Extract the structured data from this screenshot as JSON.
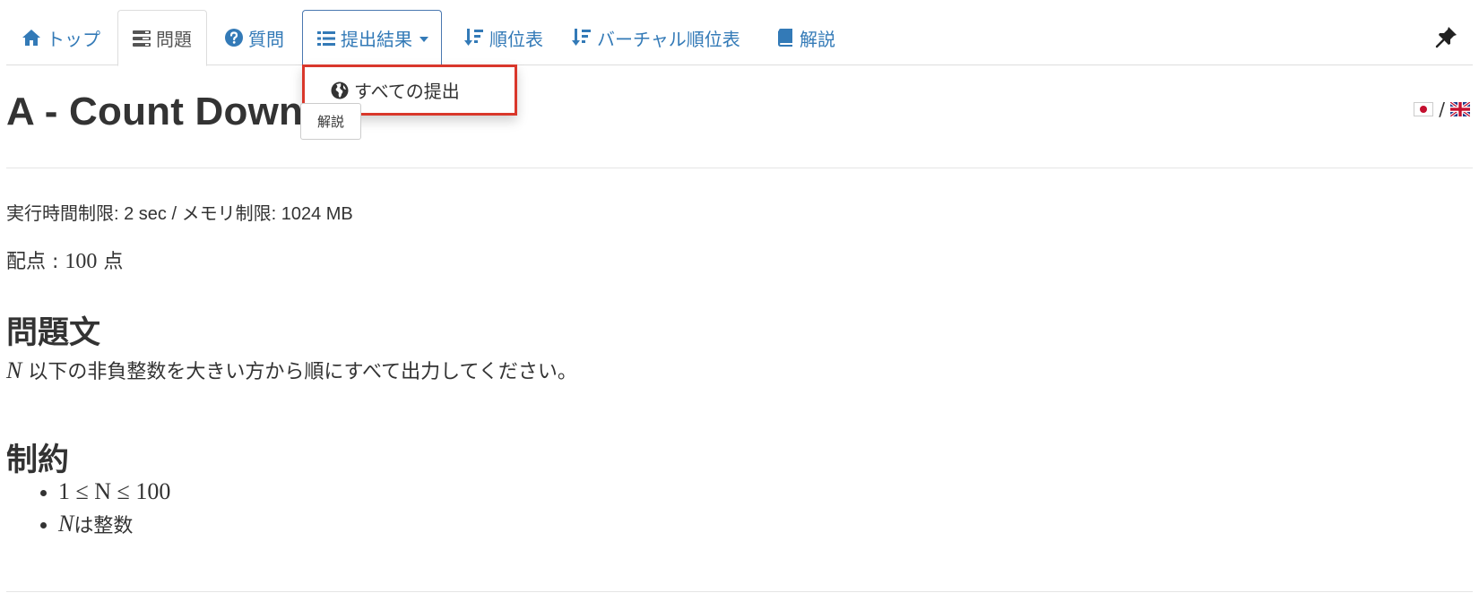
{
  "nav": {
    "tabs": [
      {
        "label": "トップ",
        "icon": "home-icon"
      },
      {
        "label": "問題",
        "icon": "tasks-icon",
        "active": true
      },
      {
        "label": "質問",
        "icon": "question-circle-icon"
      },
      {
        "label": "提出結果",
        "icon": "list-icon",
        "open": true
      },
      {
        "label": "順位表",
        "icon": "sort-amount-icon"
      },
      {
        "label": "バーチャル順位表",
        "icon": "sort-amount-icon"
      },
      {
        "label": "解説",
        "icon": "book-icon"
      }
    ],
    "pin_icon": "pushpin-icon"
  },
  "dropdown": {
    "items": [
      {
        "label": "すべての提出",
        "icon": "globe-icon"
      }
    ]
  },
  "task": {
    "title": "A - Count Down",
    "editorial_button": "解説",
    "lang_separator": "/",
    "limits": "実行時間制限: 2 sec / メモリ制限: 1024 MB",
    "score_label": "配点 :",
    "score_value": "100",
    "score_unit": "点",
    "statement_heading": "問題文",
    "statement_var": "N",
    "statement_text": " 以下の非負整数を大きい方から順にすべて出力してください。",
    "constraints_heading": "制約",
    "constraint_1": "1 ≤ N ≤ 100",
    "constraint_2_var": "N",
    "constraint_2_text": " は整数"
  },
  "colors": {
    "link": "#337ab7",
    "highlight": "#d9372b",
    "text": "#333333"
  }
}
